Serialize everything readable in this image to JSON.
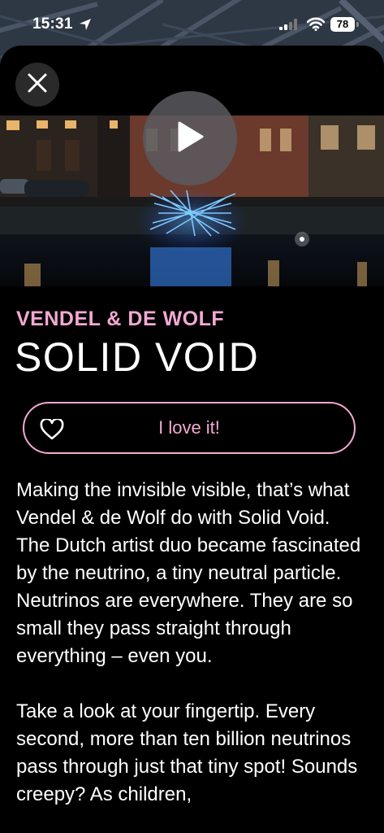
{
  "status_bar": {
    "time": "15:31",
    "battery": "78",
    "icons": [
      "location-arrow-icon",
      "signal-icon",
      "wifi-icon",
      "battery-icon"
    ]
  },
  "sheet": {
    "close_icon": "close-icon",
    "play_icon": "play-icon",
    "artist": "VENDEL & DE WOLF",
    "title": "SOLID VOID",
    "love_button": {
      "icon": "heart-icon",
      "label": "I love it!"
    },
    "description": [
      "Making the invisible visible, that’s what Vendel & de Wolf do with Solid Void. The Dutch artist duo became fascinated by the neutrino, a tiny neutral particle. Neutrinos are everywhere. They are so small they pass straight through everything – even you.",
      "Take a look at your fingertip. Every second, more than ten billion neutrinos pass through just that tiny spot! Sounds creepy? As children,"
    ]
  },
  "colors": {
    "accent_pink": "#f3a9d3",
    "background": "#000000",
    "close_button_bg": "#2a2a2a",
    "play_button_bg": "#5a5a5f"
  }
}
